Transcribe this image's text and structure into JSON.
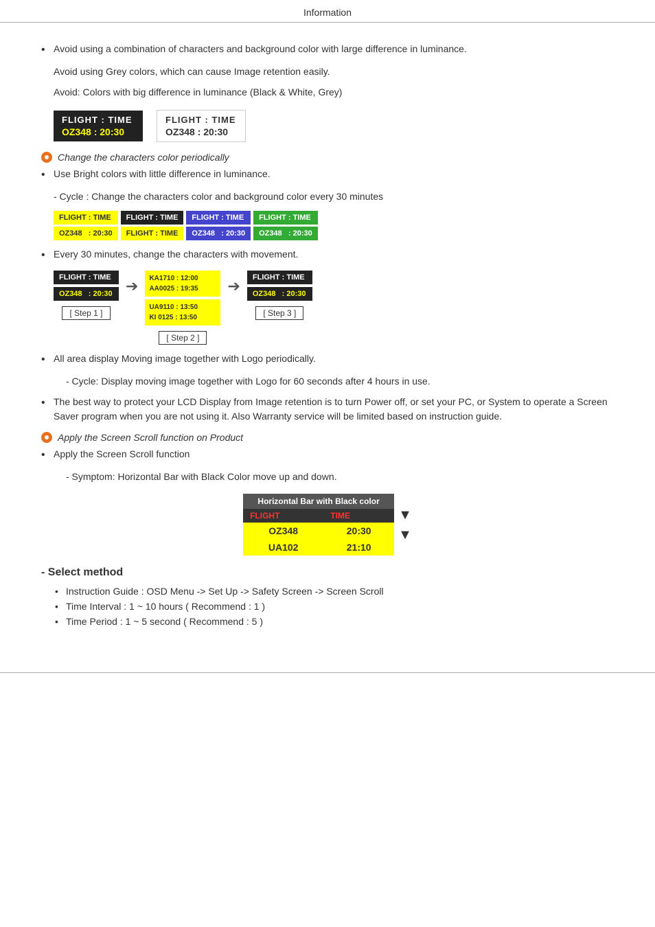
{
  "header": {
    "title": "Information"
  },
  "page": {
    "bullet1": "Avoid using a combination of characters and background color with large difference in luminance.",
    "indent1": "Avoid using Grey colors, which can cause Image retention easily.",
    "indent2": "Avoid: Colors with big difference in luminance (Black & White, Grey)",
    "dark_box": {
      "row1": "FLIGHT  :  TIME",
      "row2": "OZ348   :  20:30"
    },
    "light_box": {
      "row1": "FLIGHT  :  TIME",
      "row2": "OZ348    :  20:30"
    },
    "orange_label1": "Change the characters color periodically",
    "bullet2": "Use Bright colors with little difference in luminance.",
    "indent3": "- Cycle : Change the characters color and background color every 30 minutes",
    "cycle_boxes": [
      {
        "row1": "FLIGHT : TIME",
        "row2": "OZ348   : 20:30",
        "style": "yellow"
      },
      {
        "row1": "FLIGHT : TIME",
        "row2": "FLIGHT : TIME",
        "style": "black"
      },
      {
        "row1": "FLIGHT : TIME",
        "row2": "OZ348   : 20:30",
        "style": "blue"
      },
      {
        "row1": "FLIGHT : TIME",
        "row2": "OZ348   : 20:30",
        "style": "green"
      }
    ],
    "bullet3": "Every 30 minutes, change the characters with movement.",
    "step1": {
      "row1": "FLIGHT : TIME",
      "row2": "OZ348   : 20:30",
      "label": "[ Step 1 ]"
    },
    "step2": {
      "row1": "KA1710 : 12:00\nAA0025 : 19:35",
      "row2": "UA9110 : 13:50\nKI 0125 : 13:50",
      "label": "[ Step 2 ]"
    },
    "step3": {
      "row1": "FLIGHT : TIME",
      "row2": "OZ348   : 20:30",
      "label": "[ Step 3 ]"
    },
    "bullet4": "All area display Moving image together with Logo periodically.",
    "indent4": "- Cycle: Display moving image together with Logo for 60 seconds after 4 hours in use.",
    "bullet5": "The best way to protect your LCD Display from Image retention is to turn Power off, or set your PC, or System to operate a Screen Saver program when you are not using it. Also Warranty service will be limited based on instruction guide.",
    "orange_label2": "Apply the Screen Scroll function on Product",
    "bullet6": "Apply the Screen Scroll function",
    "indent5": "- Symptom: Horizontal Bar with Black Color move up and down.",
    "scroll_header": "Horizontal Bar with Black color",
    "scroll_title_flight": "FLIGHT",
    "scroll_title_time": "TIME",
    "scroll_row1": [
      "OZ348",
      "20:30"
    ],
    "scroll_row2": [
      "UA102",
      "21:10"
    ],
    "select_method": "- Select method",
    "sub_bullets": [
      "Instruction Guide : OSD Menu -> Set Up -> Safety Screen -> Screen Scroll",
      "Time Interval : 1 ~ 10 hours ( Recommend : 1 )",
      "Time Period : 1 ~ 5 second ( Recommend : 5 )"
    ]
  }
}
